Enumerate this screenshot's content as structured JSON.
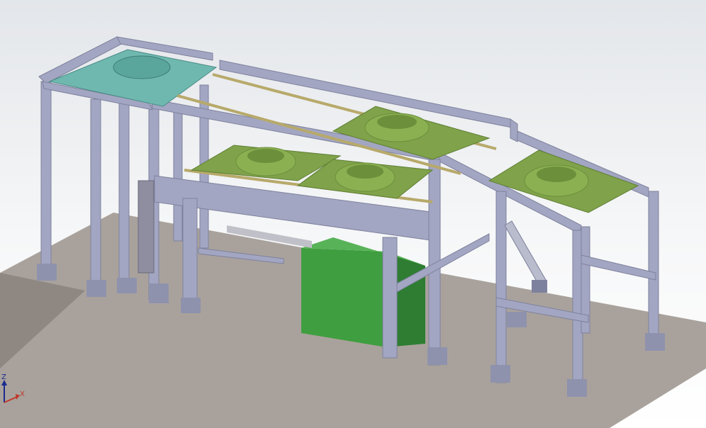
{
  "viewport": {
    "background_top": "#e3e6ea",
    "background_bottom": "#ffffff"
  },
  "colors": {
    "floor": "#a9a29c",
    "frame": "#a3a6c2",
    "frame_dark": "#7e819d",
    "frame_light": "#c3c6dc",
    "plate": "#7fa24a",
    "plate_dark": "#5f7f34",
    "fixture": "#8ab052",
    "fixture_dark": "#6c8f3b",
    "cabinet": "#3f9e3f",
    "cabinet_dark": "#2e7d32",
    "mesh": "#6fb8b0",
    "rail": "#b7a96a",
    "axis_z": "#1b2a8f",
    "axis_x": "#c0392b"
  },
  "triad": {
    "z_label": "Z",
    "x_label": "X",
    "icon": "coordinate-axes-icon"
  }
}
